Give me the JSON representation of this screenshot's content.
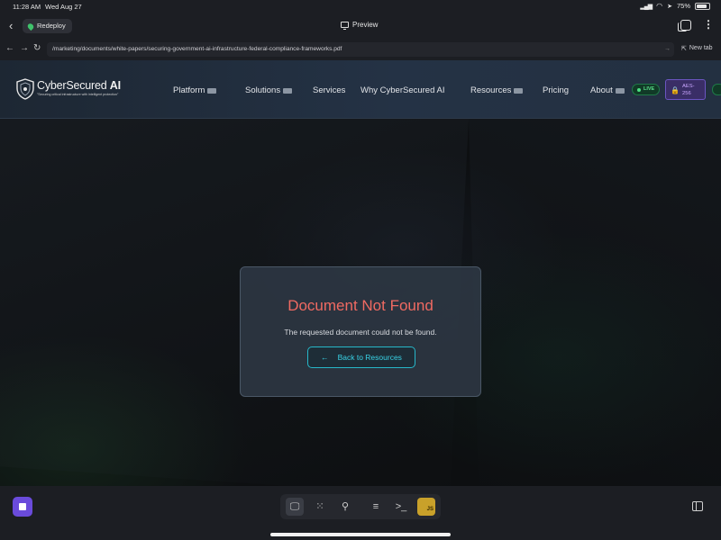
{
  "status_bar": {
    "time": "11:28 AM",
    "date": "Wed Aug 27",
    "battery": "75%"
  },
  "app_bar": {
    "project_name": "Redeploy",
    "title": "Preview"
  },
  "url_bar": {
    "url": "/marketing/documents/white-papers/securing-government-ai-infrastructure-federal-compliance-frameworks.pdf",
    "new_tab_label": "New tab"
  },
  "site": {
    "brand": {
      "name_part1": "CyberSecured",
      "name_part2": "AI",
      "tagline": "\"Securing critical infrastructure with intelligent protection\""
    },
    "nav": [
      {
        "label": "Platform",
        "dropdown": true
      },
      {
        "label": "Solutions",
        "dropdown": true
      },
      {
        "label": "Services",
        "dropdown": false
      },
      {
        "label": "Why CyberSecured AI",
        "dropdown": false
      },
      {
        "label": "Resources",
        "dropdown": true
      },
      {
        "label": "Pricing",
        "dropdown": false
      },
      {
        "label": "About",
        "dropdown": true
      }
    ],
    "live_badge": "LIVE",
    "encryption_badge": "AES-256"
  },
  "error_card": {
    "title": "Document Not Found",
    "message": "The requested document could not be found.",
    "back_button": "Back to Resources"
  },
  "dock": {
    "tools": [
      "preview-icon",
      "apps-icon",
      "deploy-icon",
      "database-icon",
      "terminal-icon",
      "js-icon"
    ],
    "js_label": "JS"
  },
  "colors": {
    "error_title": "#f06a62",
    "accent_cyan": "#38d3e6",
    "live_green": "#5be08b",
    "stop_button": "#6a4bdb"
  }
}
